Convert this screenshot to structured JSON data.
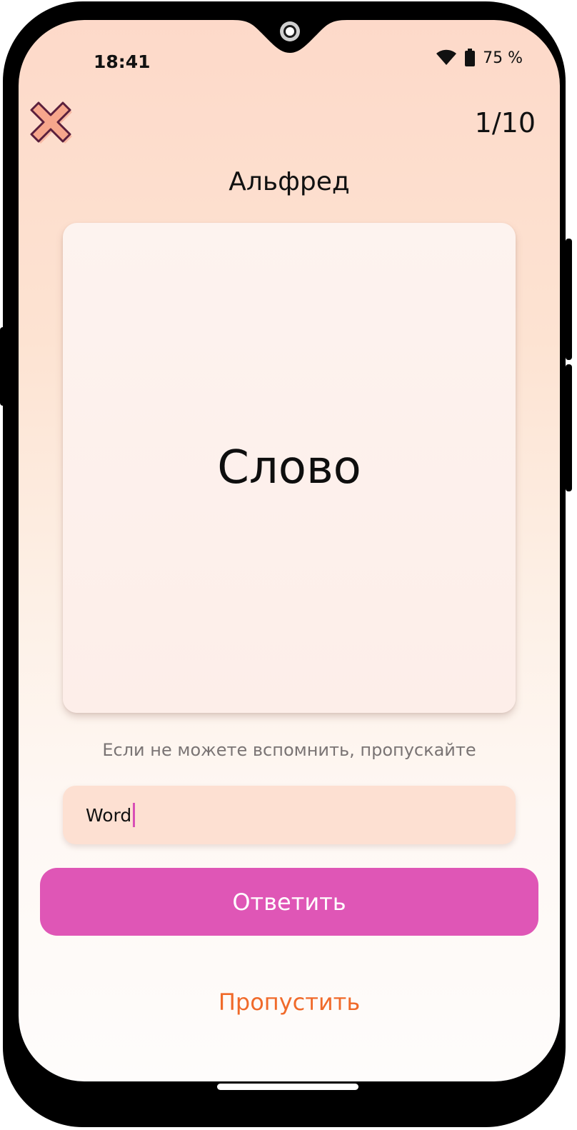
{
  "status_bar": {
    "time": "18:41",
    "battery": "75 %",
    "icons": [
      "wifi-icon",
      "battery-icon"
    ]
  },
  "header": {
    "close_icon": "close-icon",
    "progress": "1/10",
    "title": "Альфред"
  },
  "card": {
    "word": "Слово"
  },
  "hint": "Если не можете вспомнить, пропускайте",
  "answer": {
    "value": "Word"
  },
  "actions": {
    "submit_label": "Ответить",
    "skip_label": "Пропустить"
  },
  "colors": {
    "accent": "#df56b6",
    "skip": "#f06a2a",
    "field_bg": "#fde0d2",
    "close_icon_fill": "#f6a68c",
    "close_icon_stroke": "#5a1f3c"
  }
}
